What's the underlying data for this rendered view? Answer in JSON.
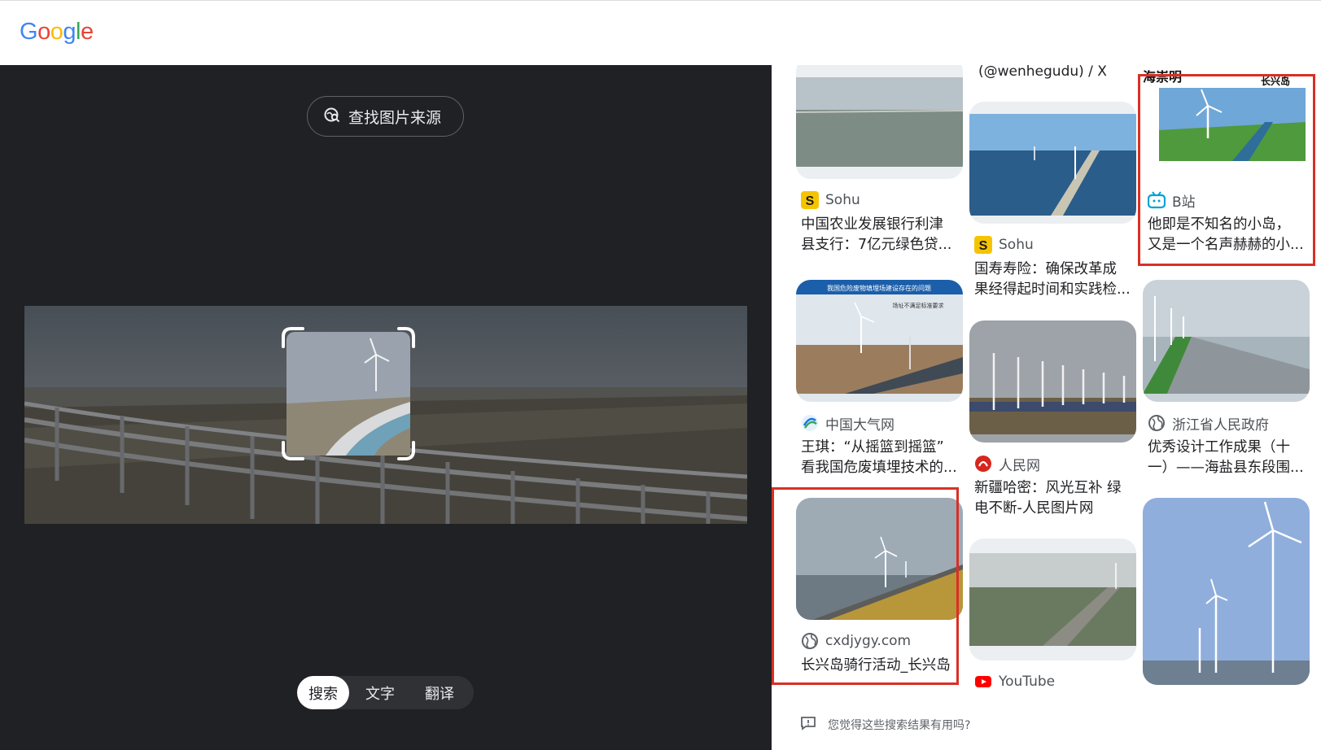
{
  "header": {
    "logo_letters": [
      {
        "ch": "G",
        "color": "#4285F4"
      },
      {
        "ch": "o",
        "color": "#EA4335"
      },
      {
        "ch": "o",
        "color": "#FBBC05"
      },
      {
        "ch": "g",
        "color": "#4285F4"
      },
      {
        "ch": "l",
        "color": "#34A853"
      },
      {
        "ch": "e",
        "color": "#EA4335"
      }
    ]
  },
  "left": {
    "source_button_label": "查找图片来源",
    "source_icon": "image-search-icon",
    "modes": [
      "搜索",
      "文字",
      "翻译"
    ],
    "active_mode": "搜索"
  },
  "results": {
    "top_partial_text": "(@wenhegudu) / X",
    "cards": [
      {
        "source": "Sohu",
        "icon": "sohu-icon",
        "title_lines": [
          "中国农业发展银行利津",
          "县支行：7亿元绿色贷..."
        ]
      },
      {
        "source": "Sohu",
        "icon": "sohu-icon",
        "title_lines": [
          "国寿寿险：确保改革成",
          "果经得起时间和实践检..."
        ]
      },
      {
        "source": "B站",
        "icon": "bilibili-icon",
        "title_lines": [
          "他即是不知名的小岛，",
          "又是一个名声赫赫的小..."
        ],
        "image_caption_left": "海崇明",
        "image_caption_right": "长兴岛"
      },
      {
        "source": "中国大气网",
        "icon": "daqi-icon",
        "title_lines": [
          "王琪：“从摇篮到摇篮”",
          "看我国危废填埋技术的..."
        ],
        "image_caption": "我国危险废物填埋场建设存在的问题",
        "image_subcaption": "场址不满足标准要求"
      },
      {
        "source": "人民网",
        "icon": "renmin-icon",
        "title_lines": [
          "新疆哈密：风光互补 绿",
          "电不断-人民图片网"
        ]
      },
      {
        "source": "浙江省人民政府",
        "icon": "globe-icon",
        "title_lines": [
          "优秀设计工作成果（十",
          "一）——海盐县东段围..."
        ]
      },
      {
        "source": "cxdjygy.com",
        "icon": "globe-icon",
        "title_lines": [
          "长兴岛骑行活动_长兴岛"
        ]
      },
      {
        "source": "YouTube",
        "icon": "youtube-icon",
        "title_lines": []
      }
    ]
  },
  "footer": {
    "feedback_text": "您觉得这些搜索结果有用吗?"
  }
}
